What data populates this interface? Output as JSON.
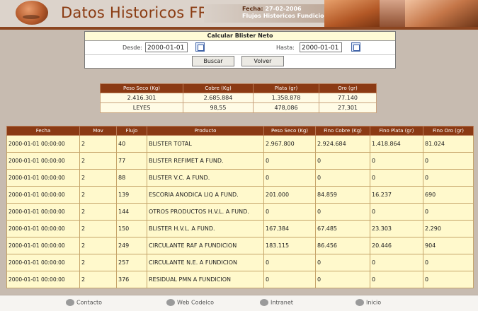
{
  "header": {
    "title": "Datos Historicos FRV",
    "date_label": "Fecha:",
    "date_value": "27-02-2006",
    "subtitle": "Flujos Historicos Fundicion"
  },
  "form": {
    "title": "Calcular Blister Neto",
    "desde_label": "Desde:",
    "desde_value": "2000-01-01",
    "hasta_label": "Hasta:",
    "hasta_value": "2000-01-01",
    "buscar_label": "Buscar",
    "volver_label": "Volver"
  },
  "summary": {
    "headers": [
      "Peso Seco (Kg)",
      "Cobre (Kg)",
      "Plata (gr)",
      "Oro (gr)"
    ],
    "rows": [
      [
        "2.416.301",
        "2.685.884",
        "1.358.878",
        "77.140"
      ],
      [
        "LEYES",
        "98,55",
        "478,086",
        "27,301"
      ]
    ]
  },
  "table": {
    "headers": [
      "Fecha",
      "Mov",
      "Flujo",
      "Producto",
      "Peso Seco (Kg)",
      "Fino Cobre (Kg)",
      "Fino Plata (gr)",
      "Fino Oro (gr)"
    ],
    "rows": [
      [
        "2000-01-01 00:00:00",
        "2",
        "40",
        "BLISTER TOTAL",
        "2.967.800",
        "2.924.684",
        "1.418.864",
        "81.024"
      ],
      [
        "2000-01-01 00:00:00",
        "2",
        "77",
        "BLISTER REFIMET A FUND.",
        "0",
        "0",
        "0",
        "0"
      ],
      [
        "2000-01-01 00:00:00",
        "2",
        "88",
        "BLISTER V.C. A FUND.",
        "0",
        "0",
        "0",
        "0"
      ],
      [
        "2000-01-01 00:00:00",
        "2",
        "139",
        "ESCORIA ANODICA LIQ A FUND.",
        "201.000",
        "84.859",
        "16.237",
        "690"
      ],
      [
        "2000-01-01 00:00:00",
        "2",
        "144",
        "OTROS PRODUCTOS H.V.L. A FUND.",
        "0",
        "0",
        "0",
        "0"
      ],
      [
        "2000-01-01 00:00:00",
        "2",
        "150",
        "BLISTER H.V.L. A FUND.",
        "167.384",
        "67.485",
        "23.303",
        "2.290"
      ],
      [
        "2000-01-01 00:00:00",
        "2",
        "249",
        "CIRCULANTE RAF A FUNDICION",
        "183.115",
        "86.456",
        "20.446",
        "904"
      ],
      [
        "2000-01-01 00:00:00",
        "2",
        "257",
        "CIRCULANTE N.E. A FUNDICION",
        "0",
        "0",
        "0",
        "0"
      ],
      [
        "2000-01-01 00:00:00",
        "2",
        "376",
        "RESIDUAL PMN A FUNDICION",
        "0",
        "0",
        "0",
        "0"
      ]
    ]
  },
  "footer": {
    "links": [
      {
        "label": "Contacto",
        "icon": "globe-icon"
      },
      {
        "label": "Web Codelco",
        "icon": "globe-icon"
      },
      {
        "label": "Intranet",
        "icon": "globe-icon"
      },
      {
        "label": "Inicio",
        "icon": "globe-icon"
      }
    ]
  }
}
